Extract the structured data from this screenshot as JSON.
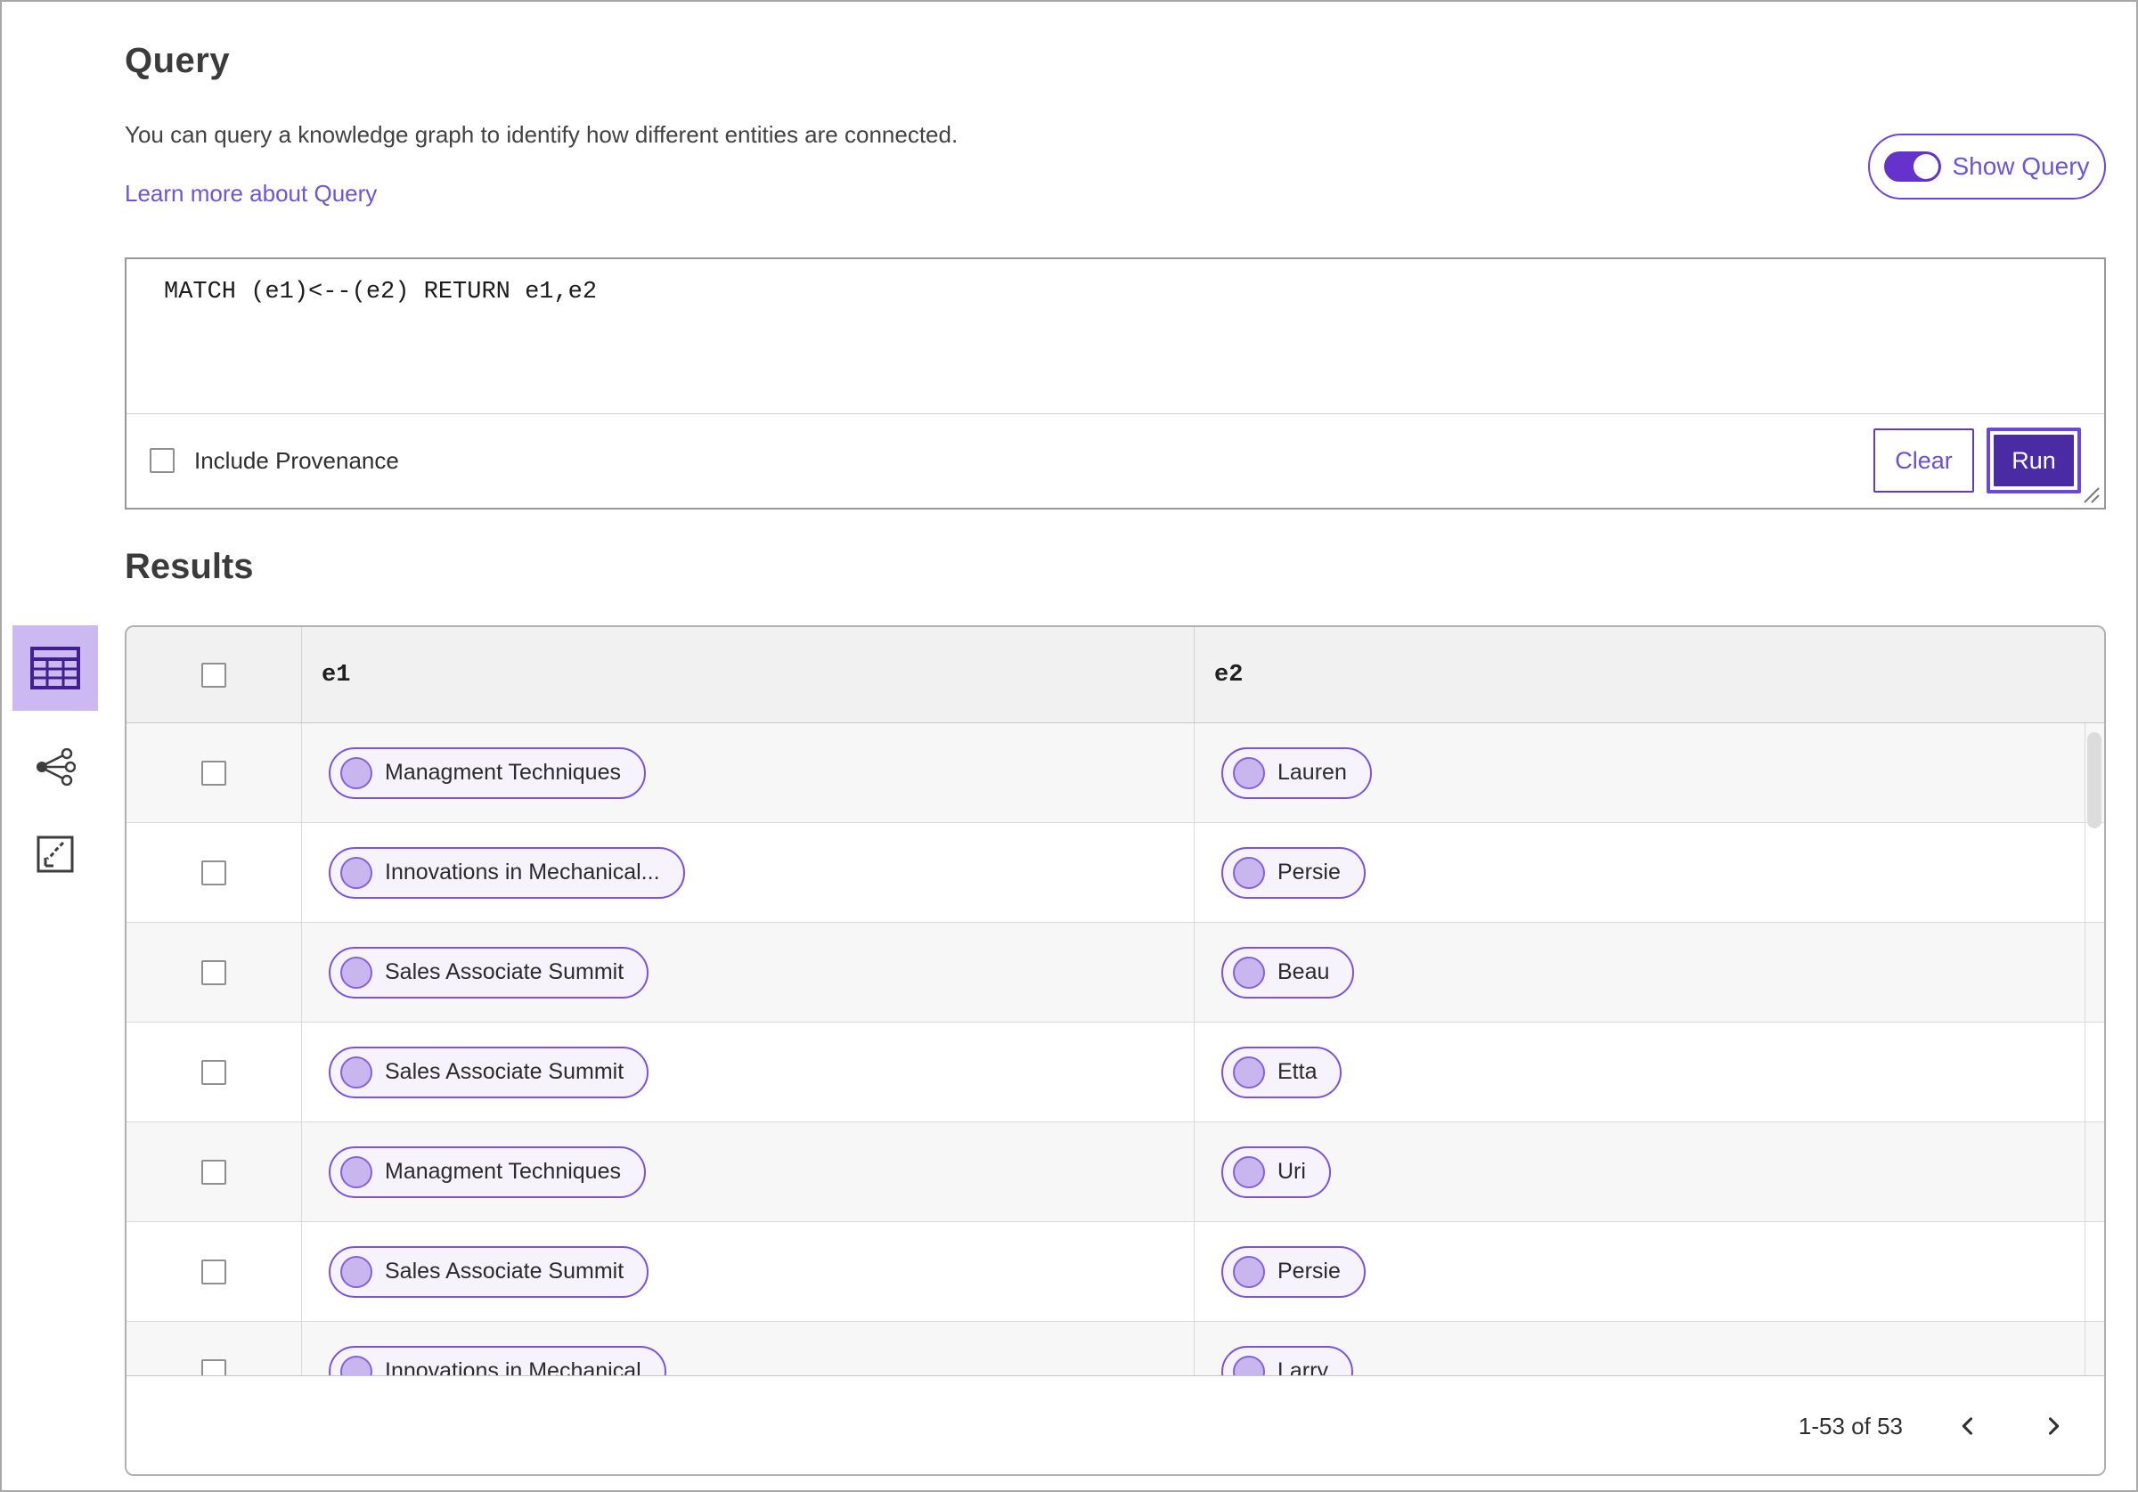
{
  "header": {
    "title": "Query",
    "description": "You can query a knowledge graph to identify how different entities are connected.",
    "learn_more_link": "Learn more about Query",
    "show_query_label": "Show Query",
    "show_query_on": true
  },
  "query_editor": {
    "query_text": "MATCH (e1)<--(e2) RETURN e1,e2",
    "include_provenance_label": "Include Provenance",
    "include_provenance_checked": false,
    "clear_label": "Clear",
    "run_label": "Run"
  },
  "results": {
    "title": "Results",
    "view_switcher": [
      "table-view",
      "graph-view",
      "expand-view"
    ],
    "table": {
      "columns": [
        "e1",
        "e2"
      ],
      "rows": [
        {
          "e1": "Managment Techniques",
          "e2": "Lauren"
        },
        {
          "e1": "Innovations in Mechanical...",
          "e2": "Persie"
        },
        {
          "e1": "Sales Associate Summit",
          "e2": "Beau"
        },
        {
          "e1": "Sales Associate Summit",
          "e2": "Etta"
        },
        {
          "e1": "Managment Techniques",
          "e2": "Uri"
        },
        {
          "e1": "Sales Associate Summit",
          "e2": "Persie"
        },
        {
          "e1": "Innovations in Mechanical",
          "e2": "Larry"
        }
      ]
    },
    "pagination": {
      "range_text": "1-53 of 53"
    }
  },
  "colors": {
    "accent_purple": "#6632cc",
    "run_button_fill": "#4b2ba3",
    "link_purple": "#6c55d6",
    "pill_border": "#7b52e0",
    "pill_background": "#f6f3fd",
    "active_tile_background": "#cdb9f1",
    "table_stripe": "#f7f7f7",
    "header_row_background": "#f1f1f1"
  }
}
